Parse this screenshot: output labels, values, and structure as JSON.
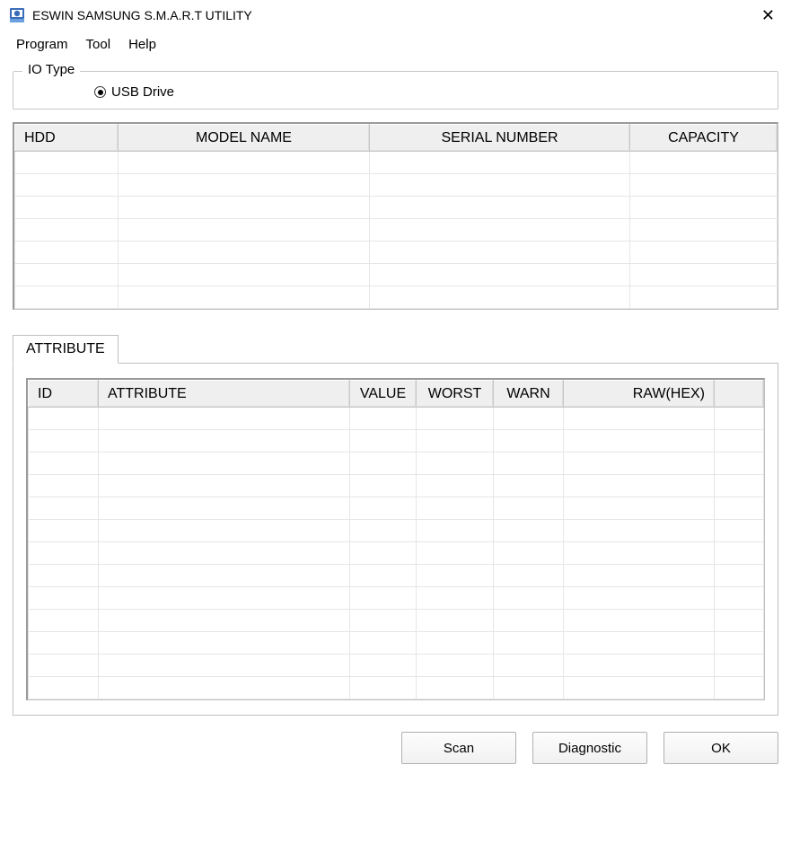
{
  "window": {
    "title": "ESWIN SAMSUNG S.M.A.R.T UTILITY"
  },
  "menu": {
    "program": "Program",
    "tool": "Tool",
    "help": "Help"
  },
  "io_group": {
    "legend": "IO Type",
    "usb_label": "USB Drive",
    "usb_selected": true
  },
  "hdd_table": {
    "headers": {
      "hdd": "HDD",
      "model": "MODEL NAME",
      "serial": "SERIAL NUMBER",
      "capacity": "CAPACITY"
    },
    "rows": [
      {
        "hdd": "",
        "model": "",
        "serial": "",
        "capacity": ""
      },
      {
        "hdd": "",
        "model": "",
        "serial": "",
        "capacity": ""
      },
      {
        "hdd": "",
        "model": "",
        "serial": "",
        "capacity": ""
      },
      {
        "hdd": "",
        "model": "",
        "serial": "",
        "capacity": ""
      },
      {
        "hdd": "",
        "model": "",
        "serial": "",
        "capacity": ""
      },
      {
        "hdd": "",
        "model": "",
        "serial": "",
        "capacity": ""
      },
      {
        "hdd": "",
        "model": "",
        "serial": "",
        "capacity": ""
      }
    ]
  },
  "tab": {
    "attribute": "ATTRIBUTE"
  },
  "attr_table": {
    "headers": {
      "id": "ID",
      "attribute": "ATTRIBUTE",
      "value": "VALUE",
      "worst": "WORST",
      "warn": "WARN",
      "raw": "RAW(HEX)",
      "extra": ""
    },
    "rows": [
      {
        "id": "",
        "attribute": "",
        "value": "",
        "worst": "",
        "warn": "",
        "raw": "",
        "extra": ""
      },
      {
        "id": "",
        "attribute": "",
        "value": "",
        "worst": "",
        "warn": "",
        "raw": "",
        "extra": ""
      },
      {
        "id": "",
        "attribute": "",
        "value": "",
        "worst": "",
        "warn": "",
        "raw": "",
        "extra": ""
      },
      {
        "id": "",
        "attribute": "",
        "value": "",
        "worst": "",
        "warn": "",
        "raw": "",
        "extra": ""
      },
      {
        "id": "",
        "attribute": "",
        "value": "",
        "worst": "",
        "warn": "",
        "raw": "",
        "extra": ""
      },
      {
        "id": "",
        "attribute": "",
        "value": "",
        "worst": "",
        "warn": "",
        "raw": "",
        "extra": ""
      },
      {
        "id": "",
        "attribute": "",
        "value": "",
        "worst": "",
        "warn": "",
        "raw": "",
        "extra": ""
      },
      {
        "id": "",
        "attribute": "",
        "value": "",
        "worst": "",
        "warn": "",
        "raw": "",
        "extra": ""
      },
      {
        "id": "",
        "attribute": "",
        "value": "",
        "worst": "",
        "warn": "",
        "raw": "",
        "extra": ""
      },
      {
        "id": "",
        "attribute": "",
        "value": "",
        "worst": "",
        "warn": "",
        "raw": "",
        "extra": ""
      },
      {
        "id": "",
        "attribute": "",
        "value": "",
        "worst": "",
        "warn": "",
        "raw": "",
        "extra": ""
      },
      {
        "id": "",
        "attribute": "",
        "value": "",
        "worst": "",
        "warn": "",
        "raw": "",
        "extra": ""
      },
      {
        "id": "",
        "attribute": "",
        "value": "",
        "worst": "",
        "warn": "",
        "raw": "",
        "extra": ""
      }
    ]
  },
  "buttons": {
    "scan": "Scan",
    "diagnostic": "Diagnostic",
    "ok": "OK"
  }
}
